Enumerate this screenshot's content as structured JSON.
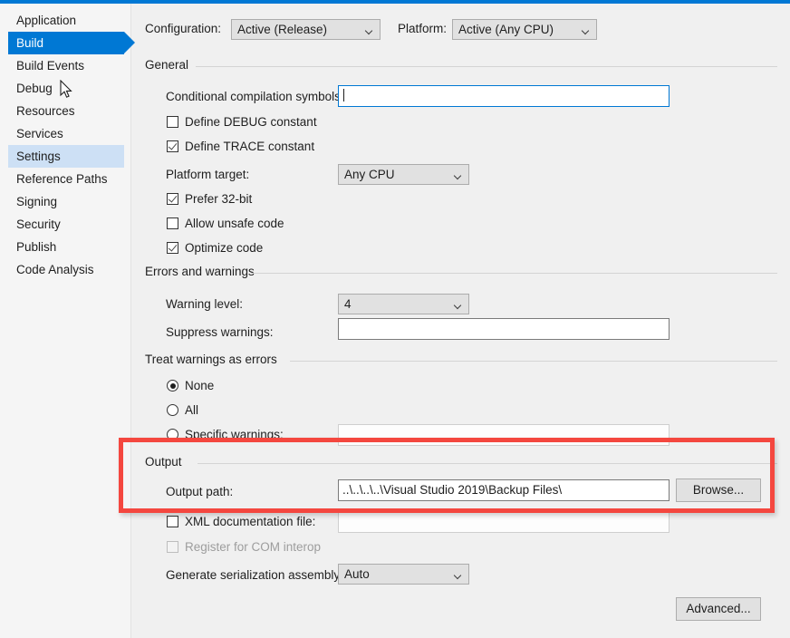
{
  "window": {
    "accent_color": "#0078d4",
    "background": "#f0f0f0"
  },
  "sidebar": {
    "items": [
      {
        "label": "Application",
        "state": "normal"
      },
      {
        "label": "Build",
        "state": "selected"
      },
      {
        "label": "Build Events",
        "state": "normal"
      },
      {
        "label": "Debug",
        "state": "normal"
      },
      {
        "label": "Resources",
        "state": "normal"
      },
      {
        "label": "Services",
        "state": "normal"
      },
      {
        "label": "Settings",
        "state": "highlighted"
      },
      {
        "label": "Reference Paths",
        "state": "normal"
      },
      {
        "label": "Signing",
        "state": "normal"
      },
      {
        "label": "Security",
        "state": "normal"
      },
      {
        "label": "Publish",
        "state": "normal"
      },
      {
        "label": "Code Analysis",
        "state": "normal"
      }
    ]
  },
  "toolbar": {
    "configuration_label": "Configuration:",
    "configuration_value": "Active (Release)",
    "platform_label": "Platform:",
    "platform_value": "Active (Any CPU)"
  },
  "general": {
    "group_label": "General",
    "conditional_symbols_label": "Conditional compilation symbols:",
    "conditional_symbols_value": "",
    "define_debug_label": "Define DEBUG constant",
    "define_debug_checked": false,
    "define_trace_label": "Define TRACE constant",
    "define_trace_checked": true,
    "platform_target_label": "Platform target:",
    "platform_target_value": "Any CPU",
    "prefer_32bit_label": "Prefer 32-bit",
    "prefer_32bit_checked": true,
    "allow_unsafe_label": "Allow unsafe code",
    "allow_unsafe_checked": false,
    "optimize_code_label": "Optimize code",
    "optimize_code_checked": true
  },
  "errors_and_warnings": {
    "group_label": "Errors and warnings",
    "warning_level_label": "Warning level:",
    "warning_level_value": "4",
    "suppress_warnings_label": "Suppress warnings:",
    "suppress_warnings_value": ""
  },
  "treat_warnings_as_errors": {
    "group_label": "Treat warnings as errors",
    "option_none": "None",
    "option_all": "All",
    "option_specific": "Specific warnings:",
    "selected": "None",
    "specific_warnings_value": ""
  },
  "output": {
    "group_label": "Output",
    "output_path_label": "Output path:",
    "output_path_value": "..\\..\\..\\..\\Visual Studio 2019\\Backup Files\\",
    "browse_label": "Browse...",
    "xml_doc_label": "XML documentation file:",
    "xml_doc_checked": false,
    "xml_doc_value": "",
    "register_com_label": "Register for COM interop",
    "register_com_checked": false,
    "register_com_disabled": true,
    "serialization_label": "Generate serialization assembly:",
    "serialization_value": "Auto"
  },
  "footer": {
    "advanced_label": "Advanced..."
  },
  "annotation": {
    "color": "#f4473f",
    "target": "Output"
  }
}
